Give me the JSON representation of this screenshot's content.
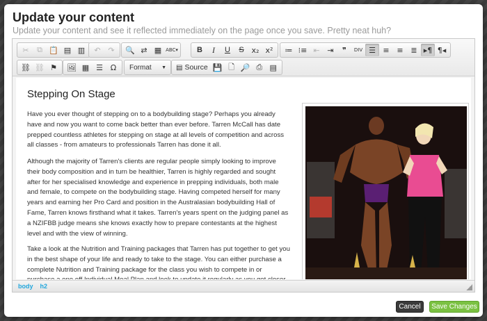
{
  "modal": {
    "title": "Update your content",
    "subtitle": "Update your content and see it reflected immediately on the page once you save. Pretty neat huh?"
  },
  "toolbar": {
    "row1": [
      {
        "name": "cut-button",
        "icon": "scissors-icon",
        "glyph": "✂",
        "disabled": true
      },
      {
        "name": "copy-button",
        "icon": "copy-icon",
        "glyph": "⧉",
        "disabled": true
      },
      {
        "name": "paste-button",
        "icon": "clipboard-icon",
        "glyph": "📋",
        "disabled": false
      },
      {
        "name": "paste-text-button",
        "icon": "clipboard-text-icon",
        "glyph": "▤",
        "disabled": false
      },
      {
        "name": "paste-word-button",
        "icon": "clipboard-word-icon",
        "glyph": "▥",
        "disabled": false
      },
      {
        "name": "undo-button",
        "icon": "undo-icon",
        "glyph": "↶",
        "disabled": true
      },
      {
        "name": "redo-button",
        "icon": "redo-icon",
        "glyph": "↷",
        "disabled": true
      },
      {
        "name": "find-button",
        "icon": "search-icon",
        "glyph": "🔍",
        "disabled": false
      },
      {
        "name": "replace-button",
        "icon": "replace-icon",
        "glyph": "⇄",
        "disabled": false
      },
      {
        "name": "select-all-button",
        "icon": "select-all-icon",
        "glyph": "▦",
        "disabled": false
      },
      {
        "name": "spellcheck-button",
        "icon": "spellcheck-icon",
        "glyph": "ABC▾",
        "disabled": false
      }
    ],
    "format_buttons": [
      {
        "name": "bold-button",
        "label": "B",
        "cls": "bold"
      },
      {
        "name": "italic-button",
        "label": "I",
        "cls": "italic"
      },
      {
        "name": "underline-button",
        "label": "U",
        "cls": "under"
      },
      {
        "name": "strikethrough-button",
        "label": "S",
        "cls": "strike"
      },
      {
        "name": "subscript-button",
        "label": "x₂",
        "cls": ""
      },
      {
        "name": "superscript-button",
        "label": "x²",
        "cls": ""
      }
    ],
    "para_buttons": [
      {
        "name": "numbered-list-button",
        "icon": "numbered-list-icon",
        "glyph": "≔",
        "active": false,
        "disabled": false
      },
      {
        "name": "bullet-list-button",
        "icon": "bullet-list-icon",
        "glyph": "⁝≡",
        "active": false,
        "disabled": false
      },
      {
        "name": "outdent-button",
        "icon": "outdent-icon",
        "glyph": "⇤",
        "active": false,
        "disabled": true
      },
      {
        "name": "indent-button",
        "icon": "indent-icon",
        "glyph": "⇥",
        "active": false,
        "disabled": false
      },
      {
        "name": "blockquote-button",
        "icon": "quote-icon",
        "glyph": "❞",
        "active": false,
        "disabled": false
      },
      {
        "name": "div-button",
        "icon": "div-icon",
        "glyph": "DIV",
        "active": false,
        "disabled": false
      },
      {
        "name": "align-left-button",
        "icon": "align-left-icon",
        "glyph": "☰",
        "active": true,
        "disabled": false
      },
      {
        "name": "align-center-button",
        "icon": "align-center-icon",
        "glyph": "≡",
        "active": false,
        "disabled": false
      },
      {
        "name": "align-right-button",
        "icon": "align-right-icon",
        "glyph": "≡",
        "active": false,
        "disabled": false
      },
      {
        "name": "align-justify-button",
        "icon": "align-justify-icon",
        "glyph": "≣",
        "active": false,
        "disabled": false
      },
      {
        "name": "ltr-button",
        "icon": "text-direction-ltr-icon",
        "glyph": "▸¶",
        "active": true,
        "disabled": false
      },
      {
        "name": "rtl-button",
        "icon": "text-direction-rtl-icon",
        "glyph": "¶◂",
        "active": false,
        "disabled": false
      }
    ],
    "row2_links": [
      {
        "name": "link-button",
        "icon": "link-icon",
        "glyph": "⛓",
        "disabled": false
      },
      {
        "name": "unlink-button",
        "icon": "unlink-icon",
        "glyph": "⛓",
        "disabled": true
      },
      {
        "name": "anchor-button",
        "icon": "flag-icon",
        "glyph": "⚑",
        "disabled": false
      }
    ],
    "row2_insert": [
      {
        "name": "image-button",
        "icon": "image-icon",
        "glyph": "🖼"
      },
      {
        "name": "table-button",
        "icon": "table-icon",
        "glyph": "▦"
      },
      {
        "name": "horizontal-line-button",
        "icon": "horizontal-line-icon",
        "glyph": "☰"
      },
      {
        "name": "special-char-button",
        "icon": "omega-icon",
        "glyph": "Ω"
      }
    ],
    "format_label": "Format",
    "source_label": "Source",
    "row2_doc": [
      {
        "name": "save-doc-button",
        "icon": "save-icon",
        "glyph": "💾",
        "disabled": true
      },
      {
        "name": "new-page-button",
        "icon": "new-page-icon",
        "glyph": "🗋",
        "disabled": false
      },
      {
        "name": "preview-button",
        "icon": "preview-icon",
        "glyph": "🔎",
        "disabled": false
      },
      {
        "name": "print-button",
        "icon": "print-icon",
        "glyph": "⎙",
        "disabled": false
      },
      {
        "name": "templates-button",
        "icon": "templates-icon",
        "glyph": "▤",
        "disabled": false
      }
    ]
  },
  "content": {
    "heading": "Stepping On Stage",
    "paragraphs": [
      "Have you ever thought of stepping on to a bodybuilding stage? Perhaps you already have and now you want to come back better than ever before. Tarren McCall has date prepped countless athletes for stepping on stage at all levels of competition and across all classes - from amateurs to professionals Tarren has done it all.",
      "Although the majority of Tarren's clients are regular people simply looking to improve their body composition and in turn be healthier, Tarren is highly regarded and sought after for her specialised knowledge and experience in prepping individuals, both male and female, to compete on the bodybuilding stage. Having competed herself for many years and earning her Pro Card and position in the Australasian bodybuilding Hall of Fame, Tarren knows firsthand what it takes. Tarren's years spent on the judging panel as a NZIFBB judge means she knows exactly how to prepare contestants at the highest level and with the view of winning.",
      "Take a look at the Nutrition and Training packages that Tarren has put together to get you in the best shape of your life and ready to take to the stage. You can either purchase a complete Nutrition and Training package for the class you wish to compete in or purchase a one off Individual Meal Plan and look to update it regularly as you get closer and closer to"
    ],
    "photo_icon": "bodybuilding-stage-photo"
  },
  "statusbar": {
    "path": [
      "body",
      "h2"
    ]
  },
  "footer": {
    "cancel_label": "Cancel",
    "save_label": "Save Changes"
  },
  "colors": {
    "save_button": "#7bc142",
    "cancel_button": "#3b3b3b",
    "status_path": "#22a7dd"
  }
}
